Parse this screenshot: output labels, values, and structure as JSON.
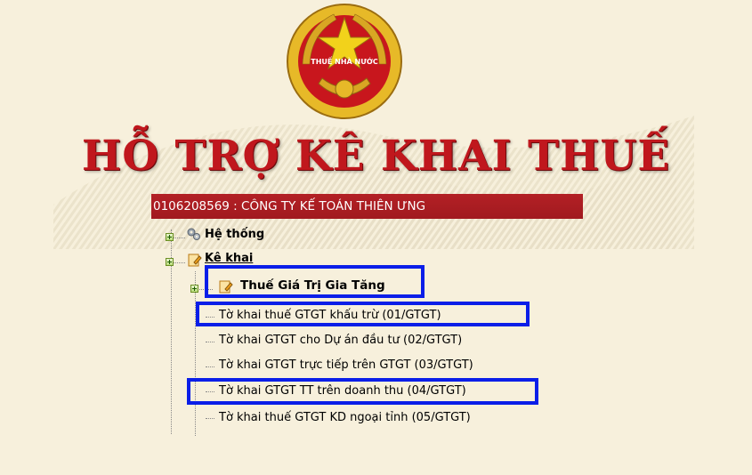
{
  "emblem": {
    "text": "THUẾ NHÀ NƯỚC"
  },
  "title": "HỖ TRỢ KÊ KHAI THUẾ",
  "company": "0106208569 : CÔNG TY KẾ TOÁN THIÊN ƯNG",
  "tree": {
    "he_thong": "Hệ thống",
    "ke_khai": "Kê khai",
    "gtgt": "Thuế Giá Trị Gia Tăng",
    "forms": [
      "Tờ khai thuế GTGT khấu trừ (01/GTGT)",
      "Tờ khai GTGT cho Dự án đầu tư (02/GTGT)",
      "Tờ khai GTGT trực tiếp trên GTGT (03/GTGT)",
      "Tờ khai GTGT TT trên doanh thu (04/GTGT)",
      "Tờ khai thuế GTGT KD ngoại tỉnh (05/GTGT)"
    ]
  },
  "colors": {
    "accent_red": "#c0171d",
    "highlight_blue": "#0a1ee8",
    "background": "#f7f0dc"
  }
}
